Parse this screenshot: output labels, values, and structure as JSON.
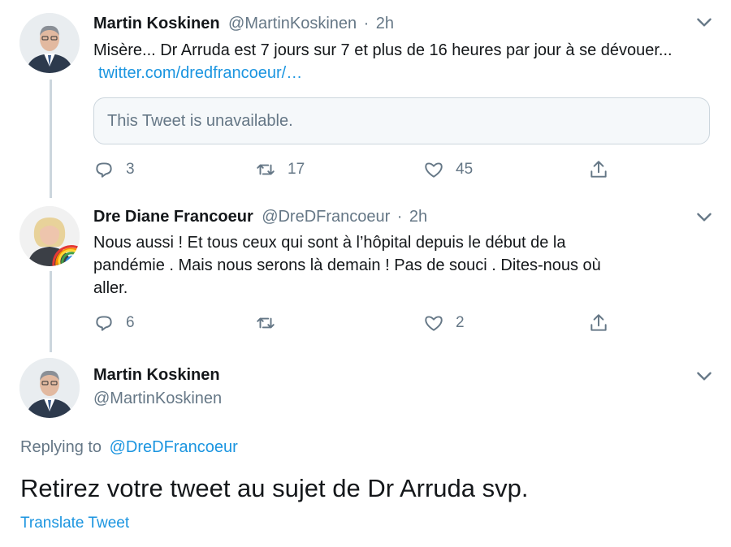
{
  "tweets": [
    {
      "name": "Martin Koskinen",
      "handle": "@MartinKoskinen",
      "sep": "·",
      "time": "2h",
      "text": "Misère...  Dr Arruda est 7 jours sur 7 et plus de 16 heures par jour à se dévouer...",
      "link": "twitter.com/dredfrancoeur/…",
      "quote": "This Tweet is unavailable.",
      "replies": "3",
      "retweets": "17",
      "likes": "45"
    },
    {
      "name": "Dre Diane Francoeur",
      "handle": "@DreDFrancoeur",
      "sep": "·",
      "time": "2h",
      "line1": "Nous aussi ! Et tous ceux qui sont à l’hôpital depuis le début de la",
      "line2": "pandémie . Mais nous serons là demain ! Pas de souci . Dites-nous où",
      "line3": "aller.",
      "replies": "6",
      "retweets": "",
      "likes": "2"
    }
  ],
  "focus": {
    "name": "Martin Koskinen",
    "handle": "@MartinKoskinen",
    "replying_prefix": "Replying to",
    "replying_to": "@DreDFrancoeur",
    "text": "Retirez votre tweet au sujet de Dr Arruda svp.",
    "translate": "Translate Tweet"
  },
  "icons": [
    "chevron-down-icon",
    "reply-icon",
    "retweet-icon",
    "like-icon",
    "share-icon"
  ],
  "colors": {
    "link": "#1b95e0",
    "muted": "#657786",
    "line": "#ccd6dd"
  }
}
